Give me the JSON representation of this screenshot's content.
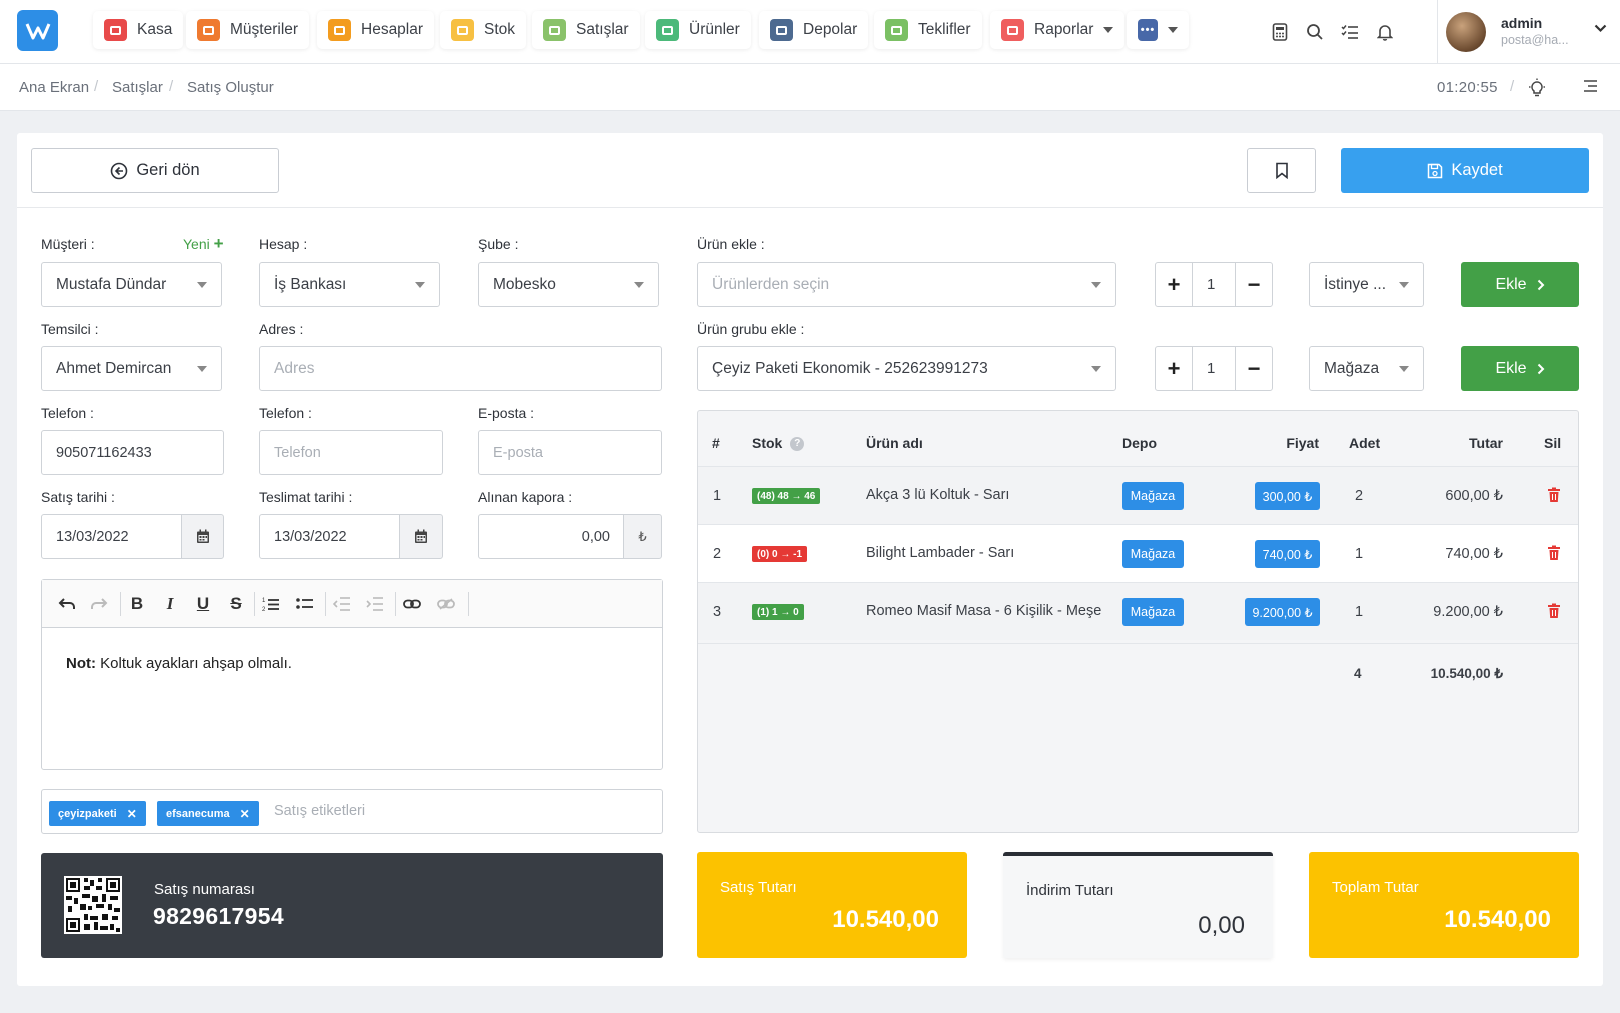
{
  "nav": {
    "items": [
      {
        "label": "Kasa",
        "color": "#e84a4a",
        "icon": "cash-icon"
      },
      {
        "label": "Müşteriler",
        "color": "#ef7a30",
        "icon": "users-icon"
      },
      {
        "label": "Hesaplar",
        "color": "#f39c1f",
        "icon": "accounts-icon"
      },
      {
        "label": "Stok",
        "color": "#f7c042",
        "icon": "stock-icon"
      },
      {
        "label": "Satışlar",
        "color": "#8ac26a",
        "icon": "sales-icon"
      },
      {
        "label": "Ürünler",
        "color": "#4cb97a",
        "icon": "products-icon"
      },
      {
        "label": "Depolar",
        "color": "#4d6a90",
        "icon": "warehouse-icon"
      },
      {
        "label": "Teklifler",
        "color": "#7bc064",
        "icon": "offers-icon"
      },
      {
        "label": "Raporlar",
        "color": "#ef5e5e",
        "icon": "reports-icon"
      }
    ],
    "more_color": "#4868a8"
  },
  "user": {
    "name": "admin",
    "email": "posta@ha..."
  },
  "breadcrumb": [
    "Ana Ekran",
    "Satışlar",
    "Satış Oluştur"
  ],
  "clock": "01:20:55",
  "header": {
    "back_label": "Geri dön",
    "save_label": "Kaydet"
  },
  "form": {
    "musteri_label": "Müşteri :",
    "yeni_label": "Yeni",
    "musteri_value": "Mustafa Dündar",
    "hesap_label": "Hesap :",
    "hesap_value": "İş Bankası",
    "sube_label": "Şube :",
    "sube_value": "Mobesko",
    "temsilci_label": "Temsilci :",
    "temsilci_value": "Ahmet Demircan",
    "adres_label": "Adres :",
    "adres_placeholder": "Adres",
    "telefon1_label": "Telefon :",
    "telefon1_value": "905071162433",
    "telefon2_label": "Telefon :",
    "telefon2_placeholder": "Telefon",
    "eposta_label": "E-posta :",
    "eposta_placeholder": "E-posta",
    "satis_tarihi_label": "Satış tarihi :",
    "satis_tarihi_value": "13/03/2022",
    "teslimat_label": "Teslimat tarihi :",
    "teslimat_value": "13/03/2022",
    "kapora_label": "Alınan kapora :",
    "kapora_value": "0,00",
    "currency": "₺"
  },
  "note": {
    "bold": "Not:",
    "text": " Koltuk ayakları ahşap olmalı."
  },
  "tags": {
    "items": [
      "çeyizpaketi",
      "efsanecuma"
    ],
    "placeholder": "Satış etiketleri"
  },
  "sale": {
    "number_label": "Satış numarası",
    "number": "9829617954"
  },
  "product_add": {
    "label": "Ürün ekle :",
    "placeholder": "Ürünlerden seçin",
    "qty": "1",
    "store": "İstinye ...",
    "button": "Ekle"
  },
  "group_add": {
    "label": "Ürün grubu ekle :",
    "value": "Çeyiz Paketi Ekonomik - 252623991273",
    "qty": "1",
    "store": "Mağaza",
    "button": "Ekle"
  },
  "table": {
    "headers": {
      "no": "#",
      "stok": "Stok",
      "urun": "Ürün adı",
      "depo": "Depo",
      "fiyat": "Fiyat",
      "adet": "Adet",
      "tutar": "Tutar",
      "sil": "Sil"
    },
    "rows": [
      {
        "no": "1",
        "stok": "(48) 48 → 46",
        "stok_color": "#43a047",
        "urun": "Akça 3 lü Koltuk - Sarı",
        "depo": "Mağaza",
        "fiyat": "300,00 ₺",
        "adet": "2",
        "tutar": "600,00 ₺"
      },
      {
        "no": "2",
        "stok": "(0) 0 → -1",
        "stok_color": "#e53935",
        "urun": "Bilight Lambader - Sarı",
        "depo": "Mağaza",
        "fiyat": "740,00 ₺",
        "adet": "1",
        "tutar": "740,00 ₺"
      },
      {
        "no": "3",
        "stok": "(1) 1 → 0",
        "stok_color": "#43a047",
        "urun": "Romeo Masif Masa - 6 Kişilik - Meşe",
        "depo": "Mağaza",
        "fiyat": "9.200,00 ₺",
        "adet": "1",
        "tutar": "9.200,00 ₺"
      }
    ],
    "total_qty": "4",
    "total": "10.540,00 ₺"
  },
  "summary": {
    "satis_label": "Satış Tutarı",
    "satis_value": "10.540,00",
    "indirim_label": "İndirim Tutarı",
    "indirim_value": "0,00",
    "toplam_label": "Toplam Tutar",
    "toplam_value": "10.540,00",
    "accent": "#fcc200"
  }
}
